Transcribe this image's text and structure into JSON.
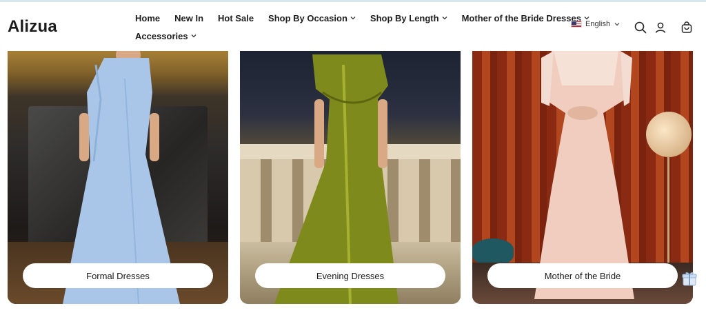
{
  "brand": {
    "name": "Alizua"
  },
  "nav": {
    "row1": [
      {
        "label": "Home",
        "dropdown": false
      },
      {
        "label": "New In",
        "dropdown": false
      },
      {
        "label": "Hot Sale",
        "dropdown": false
      },
      {
        "label": "Shop By Occasion",
        "dropdown": true
      },
      {
        "label": "Shop By Length",
        "dropdown": true
      },
      {
        "label": "Mother of the Bride Dresses",
        "dropdown": true
      }
    ],
    "row2": [
      {
        "label": "Accessories",
        "dropdown": true
      }
    ]
  },
  "language": {
    "label": "English",
    "flag": "us-flag-icon"
  },
  "header_icons": [
    "search-icon",
    "account-icon",
    "cart-icon"
  ],
  "cards": [
    {
      "label": "Formal Dresses",
      "gown_color": "#a9c6e8"
    },
    {
      "label": "Evening Dresses",
      "gown_color": "#7f8a1c"
    },
    {
      "label": "Mother of the Bride",
      "gown_color": "#f0cdbf"
    }
  ],
  "colors": {
    "top_line": "#d7e9ef",
    "pill_bg": "#ffffff",
    "text": "#1a1a1a"
  }
}
